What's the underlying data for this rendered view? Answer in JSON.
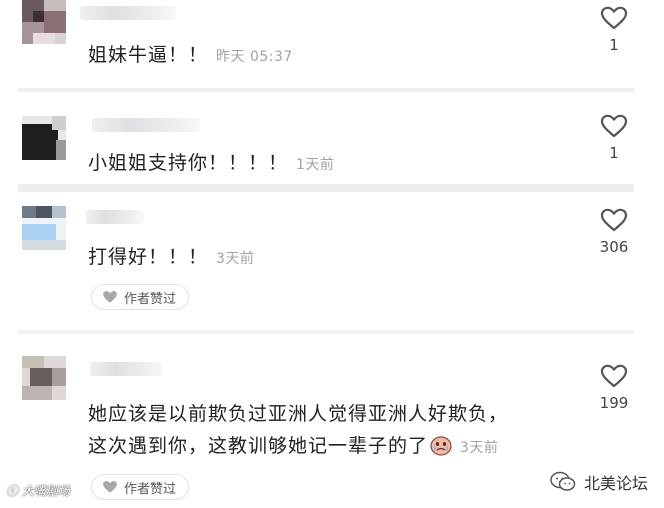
{
  "comments": [
    {
      "text": "姐妹牛逼！！",
      "time": "昨天 05:37",
      "likes": "1",
      "author_liked": false
    },
    {
      "text": "小姐姐支持你！！！！",
      "time": "1天前",
      "likes": "1",
      "author_liked": false
    },
    {
      "text": "打得好！！！",
      "time": "3天前",
      "likes": "306",
      "author_liked": true
    },
    {
      "text_line1": "她应该是以前欺负过亚洲人觉得亚洲人好欺负，",
      "text_line2": "这次遇到你，这教训够她记一辈子的了",
      "time": "3天前",
      "likes": "199",
      "author_liked": true
    }
  ],
  "author_badge_label": "作者赞过",
  "watermark_left": "ⓒ 大嘴剧场",
  "watermark_right": "北美论坛",
  "icons": {
    "like": "heart-outline-icon",
    "author_liked": "heart-filled-icon",
    "emoji": "tearful-face-emoji-icon",
    "wechat": "wechat-icon"
  },
  "colors": {
    "text": "#222222",
    "time": "#a3a3a3",
    "divider": "#eeeeef",
    "heart_stroke": "#555555",
    "badge_heart": "#a8a8a8"
  }
}
